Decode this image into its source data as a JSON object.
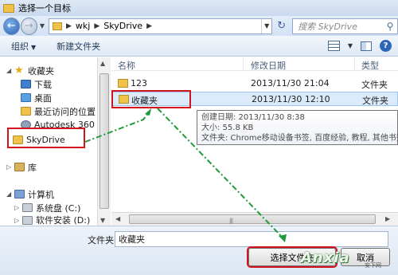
{
  "window": {
    "title": "选择一个目标"
  },
  "address": {
    "segments": [
      "wkj",
      "SkyDrive"
    ],
    "search_placeholder": "搜索 SkyDrive"
  },
  "toolbar": {
    "organize": "组织",
    "new_folder": "新建文件夹"
  },
  "nav": {
    "items": [
      {
        "label": "收藏夹"
      },
      {
        "label": "下载"
      },
      {
        "label": "桌面"
      },
      {
        "label": "最近访问的位置"
      },
      {
        "label": "Autodesk 360"
      },
      {
        "label": "SkyDrive"
      },
      {
        "label": "库"
      },
      {
        "label": "计算机"
      },
      {
        "label": "系统盘 (C:)"
      },
      {
        "label": "软件安装 (D:)"
      }
    ]
  },
  "columns": {
    "name": "名称",
    "modified": "修改日期",
    "type": "类型"
  },
  "files": [
    {
      "name": "123",
      "modified": "2013/11/30 21:04",
      "type": "文件夹"
    },
    {
      "name": "收藏夹",
      "modified": "2013/11/30 12:10",
      "type": "文件夹"
    }
  ],
  "tooltip": {
    "created": "创建日期: 2013/11/30 8:38",
    "size": "大小: 55.8 KB",
    "files": "文件夹: Chrome移动设备书签, 百度经验, 教程, 其他书签, 书"
  },
  "bottom": {
    "filename_label": "文件夹:",
    "filename_value": "收藏夹",
    "select_button": "选择文件夹",
    "cancel_button": "取消"
  },
  "watermark": {
    "logo": "Anxia",
    "small": "安下网"
  },
  "colors": {
    "highlight": "#d4141c",
    "arrow": "#1f9a3a"
  }
}
